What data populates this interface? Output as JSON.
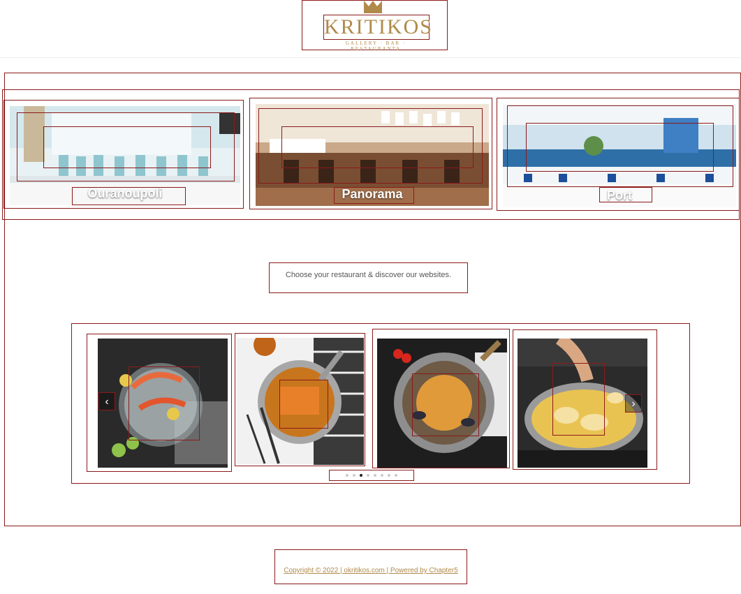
{
  "header": {
    "logo_text": "KRITIKOS",
    "logo_subtitle": "GALLERY · BAR · RESTAURANTS"
  },
  "restaurants": [
    {
      "name": "Ouranoupoli"
    },
    {
      "name": "Panorama"
    },
    {
      "name": "Port"
    }
  ],
  "intro": {
    "text": "Choose your restaurant & discover our websites."
  },
  "carousel": {
    "prev_label": "‹",
    "next_label": "›",
    "dots_count": 8,
    "active_dot": 2
  },
  "footer": {
    "text": "Copyright © 2022 | okritikos.com | Powered by Chapter5"
  },
  "colors": {
    "gold": "#b08a4a",
    "outline": "#8b1a1a"
  }
}
